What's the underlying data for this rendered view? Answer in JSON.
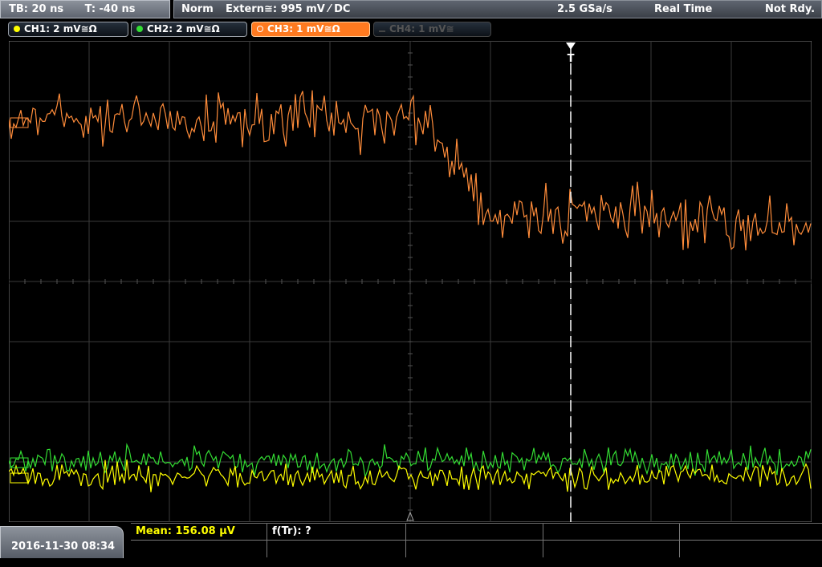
{
  "top_bar": {
    "timebase": "TB: 20 ns",
    "trigger_time": "T: -40 ns",
    "mode": "Norm",
    "trigger_source": "Extern≅: 995 mV ⁄ DC",
    "sample_rate": "2.5 GSa/s",
    "acquisition": "Real Time",
    "status": "Not Rdy."
  },
  "channels": [
    {
      "label": "CH1: 2 mV≅Ω",
      "color": "#ffff00",
      "state": "on"
    },
    {
      "label": "CH2: 2 mV≅Ω",
      "color": "#33dd33",
      "state": "on"
    },
    {
      "label": "CH3: 1 mV≅Ω",
      "color": "#ff8c3a",
      "state": "active"
    },
    {
      "label": "CH4: 1 mV≅",
      "color": "#555555",
      "state": "off"
    }
  ],
  "trigger_marker": "T",
  "measurements": {
    "mean": "Mean: 156.08 µV",
    "ftr": "f(Tr): ?"
  },
  "datetime": "2016-11-30 08:34",
  "colors": {
    "ch1": "#ffff00",
    "ch2": "#33dd33",
    "ch3": "#ff8c3a",
    "grid": "#3a3a3a",
    "trigger_line": "#ffffff",
    "measure_text": "#ffff00"
  }
}
